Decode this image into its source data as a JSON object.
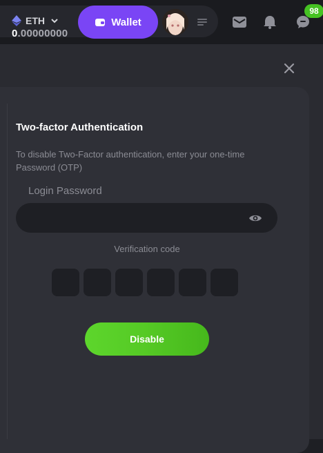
{
  "header": {
    "currency": "ETH",
    "balance_int": "0",
    "balance_dec": ".00000000",
    "wallet_label": "Wallet",
    "chat_badge": "98"
  },
  "modal": {
    "title": "Two-factor Authentication",
    "description": "To disable Two-Factor authentication, enter your one-time Password (OTP)",
    "password_label": "Login Password",
    "password_value": "",
    "verification_label": "Verification code",
    "code_digits": [
      "",
      "",
      "",
      "",
      "",
      ""
    ],
    "submit_label": "Disable"
  },
  "colors": {
    "wallet_accent": "#7a45f5",
    "submit_accent": "#55c925",
    "badge": "#45c222"
  },
  "icons": [
    "ethereum-icon",
    "chevron-down-icon",
    "wallet-icon",
    "menu-list-icon",
    "mail-icon",
    "bell-icon",
    "chat-icon",
    "close-icon",
    "eye-icon"
  ]
}
